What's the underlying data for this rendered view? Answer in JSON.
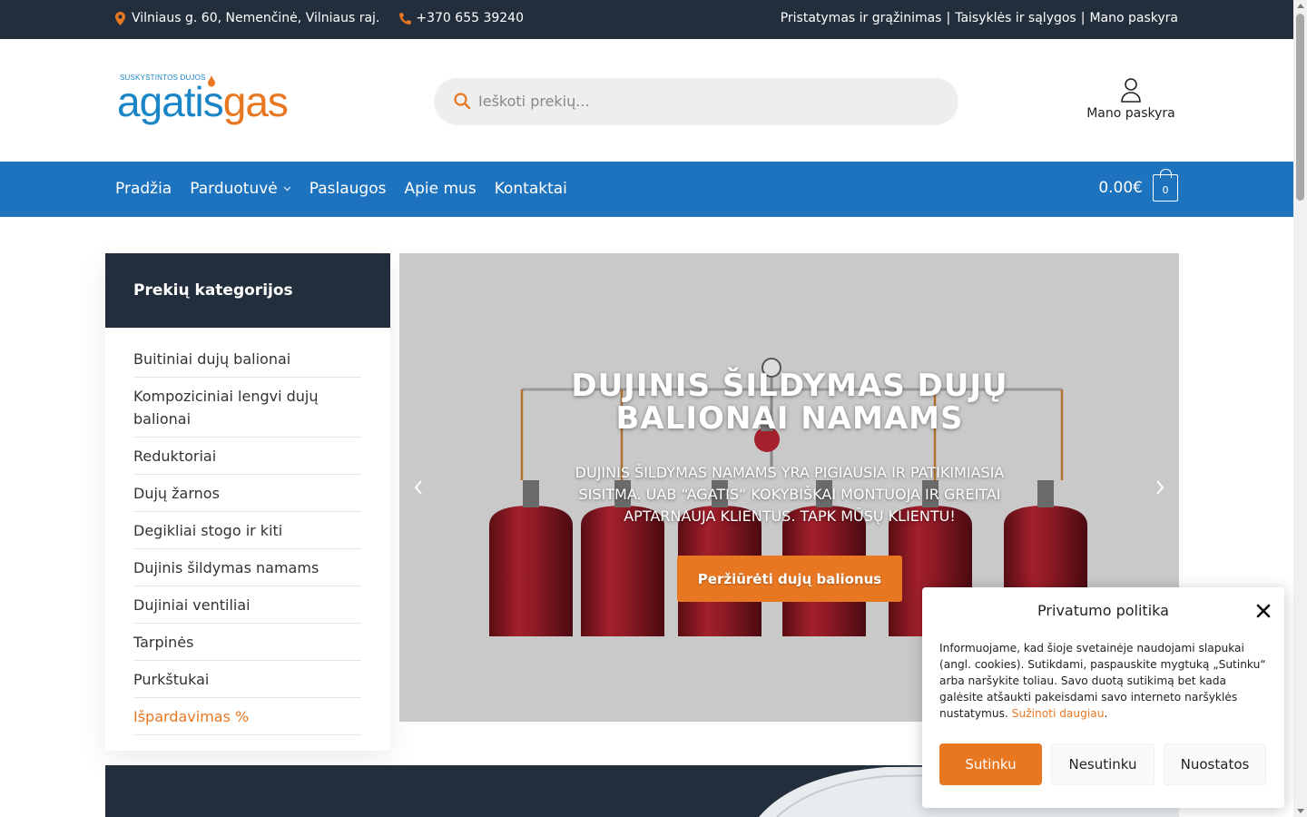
{
  "topbar": {
    "address": "Vilniaus g. 60, Nemenčinė, Vilniaus raj.",
    "phone": "+370 655 39240",
    "links": [
      "Pristatymas ir grąžinimas",
      "Taisyklės ir sąlygos",
      "Mano paskyra"
    ],
    "separator": "|"
  },
  "logo": {
    "tagline": "SUSKYSTINTOS DUJOS",
    "part1": "agatis",
    "part2": "gas"
  },
  "search": {
    "placeholder": "Ieškoti prekių..."
  },
  "account": {
    "label": "Mano paskyra"
  },
  "nav": {
    "items": [
      "Pradžia",
      "Parduotuvė",
      "Paslaugos",
      "Apie mus",
      "Kontaktai"
    ],
    "cart_total": "0.00€",
    "cart_count": "0"
  },
  "sidebar": {
    "title": "Prekių kategorijos",
    "items": [
      "Buitiniai dujų balionai",
      "Kompoziciniai lengvi dujų balionai",
      "Reduktoriai",
      "Dujų žarnos",
      "Degikliai stogo ir kiti",
      "Dujinis šildymas namams",
      "Dujiniai ventiliai",
      "Tarpinės",
      "Purkštukai",
      "Išpardavimas %"
    ]
  },
  "hero": {
    "title": "DUJINIS ŠILDYMAS DUJŲ BALIONAI NAMAMS",
    "subtitle": "DUJINIS ŠILDYMAS NAMAMS YRA PIGIAUSIA IR PATIKIMIASIA SISITMA. UAB “AGATIS“ KOKYBIŠKAI MONTUOJA IR GREITAI APTARNAUJA KLIENTUS. TAPK MŪSŲ KLIENTU!",
    "cta": "Peržiūrėti dujų balionus"
  },
  "cookie": {
    "title": "Privatumo politika",
    "text": "Informuojame, kad šioje svetainėje naudojami slapukai (angl. cookies). Sutikdami, paspauskite mygtuką „Sutinku“ arba naršykite toliau. Savo duotą sutikimą bet kada galėsite atšaukti pakeisdami savo interneto naršyklės nustatymus.",
    "link": "Sužinoti daugiau",
    "accept": "Sutinku",
    "deny": "Nesutinku",
    "settings": "Nuostatos"
  },
  "colors": {
    "accent": "#e87722",
    "nav": "#1e73be",
    "dark": "#232e3d"
  }
}
